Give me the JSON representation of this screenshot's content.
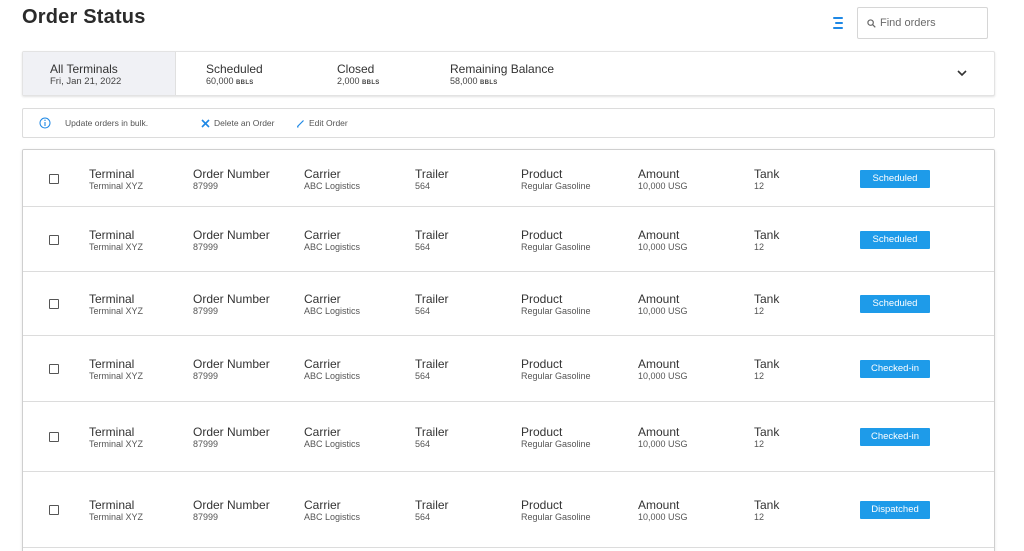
{
  "page": {
    "title": "Order Status"
  },
  "toolbar": {
    "filter_icon": "filter-lines-icon",
    "search_placeholder": "Find orders",
    "search_icon": "search-icon"
  },
  "summary": {
    "terminal": {
      "label": "All Terminals",
      "date": "Fri, Jan 21, 2022"
    },
    "stats": [
      {
        "label": "Scheduled",
        "value": "60,000",
        "unit": "BBLS"
      },
      {
        "label": "Closed",
        "value": "2,000",
        "unit": "BBLS"
      },
      {
        "label": "Remaining Balance",
        "value": "58,000",
        "unit": "BBLS"
      }
    ],
    "expand_icon": "chevron-down-icon"
  },
  "bulk": {
    "info_text": "Update orders in bulk.",
    "delete_label": "Delete an Order",
    "edit_label": "Edit Order"
  },
  "columns": {
    "terminal": "Terminal",
    "order_number": "Order Number",
    "carrier": "Carrier",
    "trailer": "Trailer",
    "product": "Product",
    "amount": "Amount",
    "tank": "Tank"
  },
  "orders": [
    {
      "terminal": "Terminal XYZ",
      "order_number": "87999",
      "carrier": "ABC Logistics",
      "trailer": "564",
      "product": "Regular Gasoline",
      "amount": "10,000 USG",
      "tank": "12",
      "status": "Scheduled"
    },
    {
      "terminal": "Terminal XYZ",
      "order_number": "87999",
      "carrier": "ABC Logistics",
      "trailer": "564",
      "product": "Regular Gasoline",
      "amount": "10,000 USG",
      "tank": "12",
      "status": "Scheduled"
    },
    {
      "terminal": "Terminal XYZ",
      "order_number": "87999",
      "carrier": "ABC Logistics",
      "trailer": "564",
      "product": "Regular Gasoline",
      "amount": "10,000 USG",
      "tank": "12",
      "status": "Scheduled"
    },
    {
      "terminal": "Terminal XYZ",
      "order_number": "87999",
      "carrier": "ABC Logistics",
      "trailer": "564",
      "product": "Regular Gasoline",
      "amount": "10,000 USG",
      "tank": "12",
      "status": "Checked-in"
    },
    {
      "terminal": "Terminal XYZ",
      "order_number": "87999",
      "carrier": "ABC Logistics",
      "trailer": "564",
      "product": "Regular Gasoline",
      "amount": "10,000 USG",
      "tank": "12",
      "status": "Checked-in"
    },
    {
      "terminal": "Terminal XYZ",
      "order_number": "87999",
      "carrier": "ABC Logistics",
      "trailer": "564",
      "product": "Regular Gasoline",
      "amount": "10,000 USG",
      "tank": "12",
      "status": "Dispatched"
    }
  ],
  "colors": {
    "accent": "#1e9be9",
    "icon_blue": "#1e88e5"
  }
}
